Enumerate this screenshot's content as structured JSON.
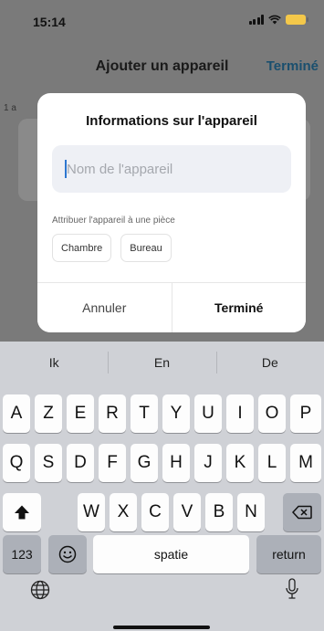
{
  "status_bar": {
    "time": "15:14"
  },
  "header": {
    "title": "Ajouter un appareil",
    "done_label": "Terminé",
    "accent": "#1a4f6e"
  },
  "page": {
    "note": "1 a"
  },
  "modal": {
    "title": "Informations sur l'appareil",
    "name_placeholder": "Nom de l'appareil",
    "name_value": "",
    "assign_label": "Attribuer l'appareil à une pièce",
    "rooms": [
      "Chambre",
      "Bureau"
    ],
    "cancel_label": "Annuler",
    "done_label": "Terminé"
  },
  "keyboard": {
    "suggestions": [
      "Ik",
      "En",
      "De"
    ],
    "row1": [
      "A",
      "Z",
      "E",
      "R",
      "T",
      "Y",
      "U",
      "I",
      "O",
      "P"
    ],
    "row2": [
      "Q",
      "S",
      "D",
      "F",
      "G",
      "H",
      "J",
      "K",
      "L",
      "M"
    ],
    "row3": [
      "W",
      "X",
      "C",
      "V",
      "B",
      "N"
    ],
    "numbers_label": "123",
    "space_label": "spatie",
    "return_label": "return",
    "icons": {
      "shift": "shift-icon",
      "backspace": "backspace-icon",
      "emoji": "emoji-icon",
      "globe": "globe-icon",
      "mic": "microphone-icon"
    }
  }
}
